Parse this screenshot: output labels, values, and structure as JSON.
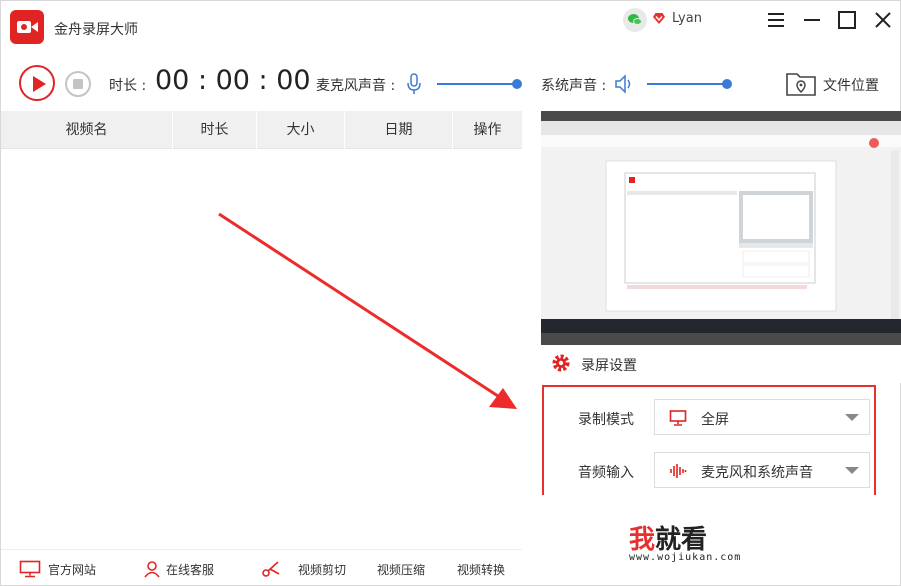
{
  "app": {
    "title": "金舟录屏大师",
    "username": "Lyan"
  },
  "toolbar": {
    "duration_label": "时长 :",
    "timer": "00 : 00 : 00",
    "mic_label": "麦克风声音 :",
    "mic_volume": 1.0,
    "sys_label": "系统声音 :",
    "sys_volume": 1.0,
    "folder_label": "文件位置"
  },
  "table": {
    "headers": [
      "视频名",
      "时长",
      "大小",
      "日期",
      "操作"
    ],
    "rows": []
  },
  "settings": {
    "title": "录屏设置",
    "mode_label": "录制模式",
    "mode_value": "全屏",
    "audio_label": "音频输入",
    "audio_value": "麦克风和系统声音"
  },
  "footer": {
    "website": "官方网站",
    "support": "在线客服",
    "edit": "视频剪切",
    "compress": "视频压缩",
    "convert": "视频转换"
  },
  "watermark": {
    "text1": "我",
    "text2": "就看",
    "url": "www.wojiukan.com"
  },
  "colors": {
    "accent": "#e02424",
    "slider": "#3a7bd5",
    "highlight_border": "#e8302f"
  }
}
